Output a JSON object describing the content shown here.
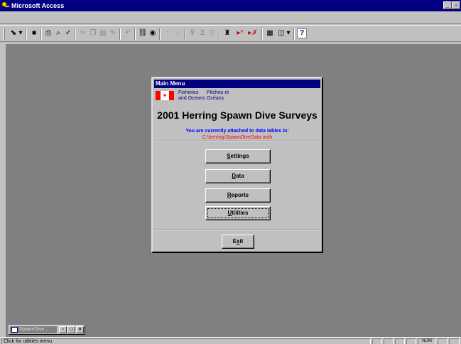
{
  "window": {
    "title": "Microsoft Access",
    "minimize_glyph": "_",
    "restore_glyph": "▫",
    "close_glyph": "×"
  },
  "toolbar": {
    "icons": [
      {
        "name": "design-view-icon",
        "glyph": "⬊"
      },
      {
        "name": "dropdown-arrow-icon",
        "glyph": "▾"
      },
      {
        "name": "save-icon",
        "glyph": "■"
      },
      {
        "name": "print-icon",
        "glyph": "⎙"
      },
      {
        "name": "print-preview-icon",
        "glyph": "⌕"
      },
      {
        "name": "spelling-icon",
        "glyph": "✓"
      },
      {
        "name": "cut-icon",
        "glyph": "✂"
      },
      {
        "name": "copy-icon",
        "glyph": "❐"
      },
      {
        "name": "paste-icon",
        "glyph": "▤"
      },
      {
        "name": "format-painter-icon",
        "glyph": "✎"
      },
      {
        "name": "undo-icon",
        "glyph": "↶"
      },
      {
        "name": "insert-hyperlink-icon",
        "glyph": "⛓"
      },
      {
        "name": "web-toolbar-icon",
        "glyph": "◉"
      },
      {
        "name": "sort-ascending-icon",
        "glyph": "↑"
      },
      {
        "name": "sort-descending-icon",
        "glyph": "↓"
      },
      {
        "name": "filter-by-selection-icon",
        "glyph": "⊽"
      },
      {
        "name": "filter-by-form-icon",
        "glyph": "⊻"
      },
      {
        "name": "apply-filter-icon",
        "glyph": "▽"
      },
      {
        "name": "find-icon",
        "glyph": "♜"
      },
      {
        "name": "new-record-icon",
        "glyph": "▸*"
      },
      {
        "name": "delete-record-icon",
        "glyph": "▸✗"
      },
      {
        "name": "database-window-icon",
        "glyph": "▦"
      },
      {
        "name": "new-object-icon",
        "glyph": "◫"
      },
      {
        "name": "new-object-dropdown-icon",
        "glyph": "▾"
      },
      {
        "name": "office-assistant-icon",
        "glyph": "?"
      }
    ]
  },
  "form": {
    "title": "Main Menu",
    "org_en_line1": "Fisheries",
    "org_en_line2": "and Oceans",
    "org_fr_line1": "Pêches et",
    "org_fr_line2": "Océans",
    "heading": "2001 Herring Spawn Dive Surveys",
    "attached_label": "You are currently attached to data tables in:",
    "attached_path": "C:\\herring\\SpawnDiveData.mdb",
    "buttons": {
      "settings": {
        "accel": "S",
        "rest": "ettings"
      },
      "data": {
        "accel": "D",
        "rest": "ata"
      },
      "reports": {
        "accel": "R",
        "rest": "eports"
      },
      "utilities": {
        "accel": "U",
        "rest": "tilities"
      },
      "exit": {
        "pre": "E",
        "accel": "x",
        "rest": "it"
      }
    },
    "colors": {
      "title_bar": "#000080",
      "attached_label": "#0000ff",
      "attached_path": "#ff0000"
    }
  },
  "minimized_window": {
    "title": "SpawnDive..."
  },
  "statusbar": {
    "text": "Click for utilities menu.",
    "num": "NUM"
  }
}
